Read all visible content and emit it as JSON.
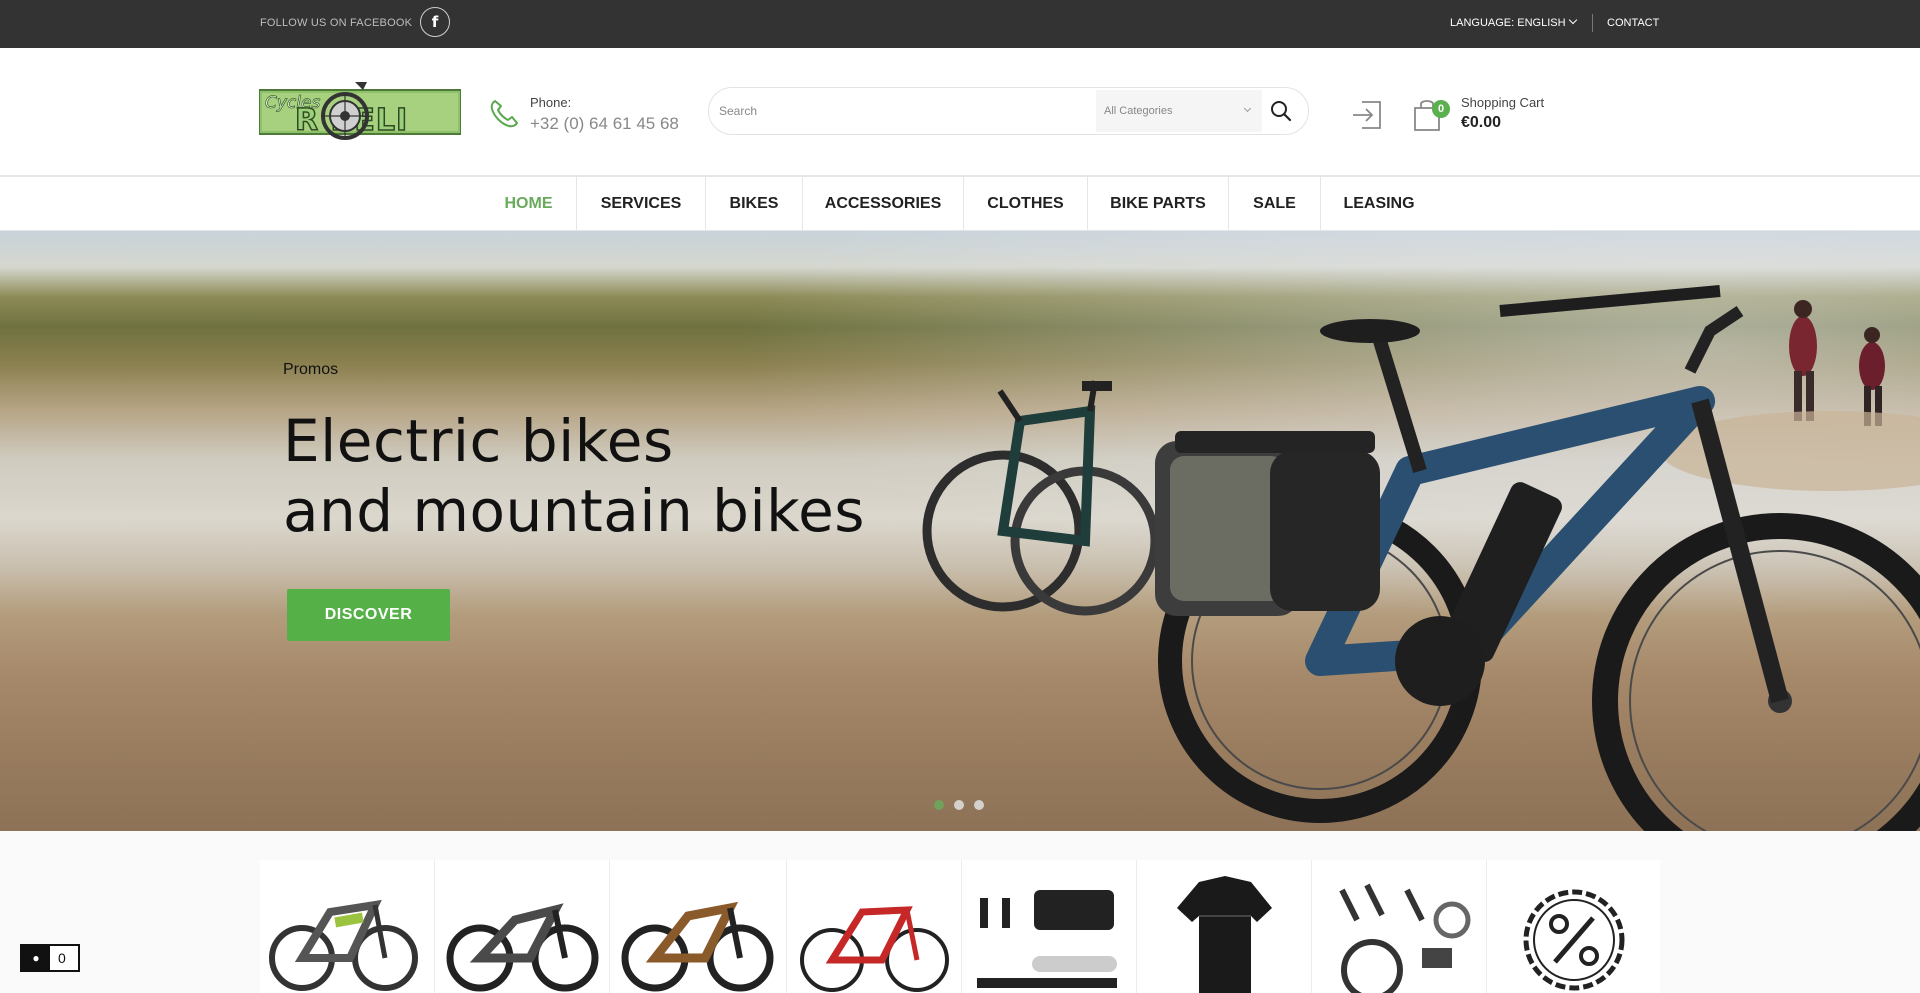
{
  "topbar": {
    "follow_text": "FOLLOW US ON FACEBOOK",
    "facebook_glyph": "f",
    "language": "LANGUAGE: ENGLISH",
    "contact": "CONTACT"
  },
  "header": {
    "logo_text": "Cycles ROBELI",
    "phone_label": "Phone:",
    "phone_number": "+32 (0) 64 61 45 68",
    "search_placeholder": "Search",
    "category_select": "All Categories",
    "cart_label": "Shopping Cart",
    "cart_total": "€0.00",
    "cart_count": "0"
  },
  "nav": {
    "items": [
      "HOME",
      "SERVICES",
      "BIKES",
      "ACCESSORIES",
      "CLOTHES",
      "BIKE PARTS",
      "SALE",
      "LEASING"
    ],
    "active": "HOME"
  },
  "hero": {
    "eyebrow": "Promos",
    "title_line1": "Electric bikes",
    "title_line2": "and mountain bikes",
    "cta": "DISCOVER",
    "slides": 3,
    "active_slide": 1
  },
  "categories": [
    {
      "name": "e-bike",
      "icon": "ebike-icon"
    },
    {
      "name": "mountain bike",
      "icon": "mtb-icon"
    },
    {
      "name": "trail bike",
      "icon": "trail-bike-icon"
    },
    {
      "name": "road bike",
      "icon": "road-bike-icon"
    },
    {
      "name": "accessories",
      "icon": "accessories-icon"
    },
    {
      "name": "clothes",
      "icon": "jersey-icon"
    },
    {
      "name": "bike parts",
      "icon": "groupset-icon"
    },
    {
      "name": "sale",
      "icon": "percent-badge-icon"
    }
  ],
  "floating_cart": {
    "count": "0",
    "icon": "basket-icon"
  },
  "colors": {
    "topbar": "#333333",
    "accent_green": "#55b048",
    "nav_active": "#6aaa5c"
  }
}
